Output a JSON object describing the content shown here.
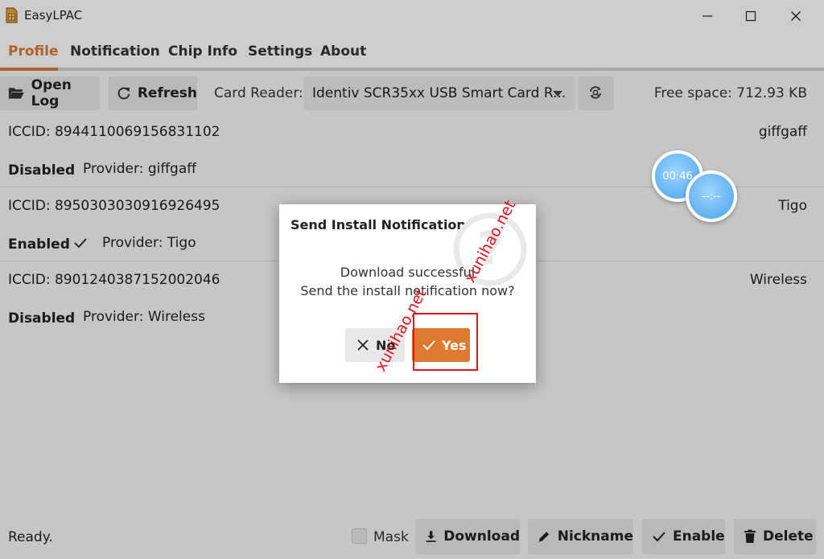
{
  "window": {
    "title": "EasyLPAC",
    "minimize_icon": "minimize-icon",
    "maximize_icon": "maximize-icon",
    "close_icon": "close-icon"
  },
  "tabs": [
    {
      "label": "Profile",
      "active": true
    },
    {
      "label": "Notification",
      "active": false
    },
    {
      "label": "Chip Info",
      "active": false
    },
    {
      "label": "Settings",
      "active": false
    },
    {
      "label": "About",
      "active": false
    }
  ],
  "toolbar": {
    "open_log_label": "Open Log",
    "refresh_label": "Refresh",
    "card_reader_label": "Card Reader:",
    "card_reader_value": "Identiv SCR35xx USB Smart Card R...",
    "free_space": "Free space: 712.93 KB"
  },
  "profiles": [
    {
      "iccid": "ICCID: 8944110069156831102",
      "state": "Disabled",
      "enabled": false,
      "provider": "Provider: giffgaff",
      "nickname": "giffgaff"
    },
    {
      "iccid": "ICCID: 8950303030916926495",
      "state": "Enabled",
      "enabled": true,
      "provider": "Provider: Tigo",
      "nickname": "Tigo"
    },
    {
      "iccid": "ICCID: 8901240387152002046",
      "state": "Disabled",
      "enabled": false,
      "provider": "Provider: Wireless",
      "nickname": "Wireless"
    }
  ],
  "bottom": {
    "status": "Ready.",
    "mask_label": "Mask",
    "download_label": "Download",
    "nickname_label": "Nickname",
    "enable_label": "Enable",
    "delete_label": "Delete"
  },
  "dialog": {
    "title": "Send Install Notification",
    "line1": "Download successful",
    "line2": "Send the install notification now?",
    "no_label": "No",
    "yes_label": "Yes"
  },
  "overlay_bubbles": {
    "timer": "00:46",
    "placeholder": "--:--"
  },
  "watermark": {
    "text1": "xunihao.net",
    "text2": "xunihao.net"
  },
  "colors": {
    "accent": "#d97832",
    "yes_button": "#e0782e",
    "highlight_box": "#e0141e"
  }
}
